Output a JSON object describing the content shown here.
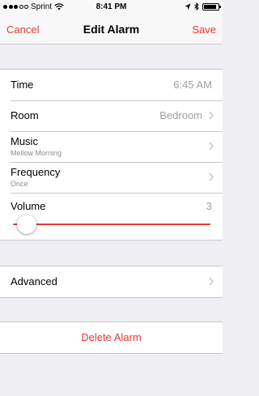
{
  "status_bar": {
    "carrier": "Sprint",
    "time": "8:41 PM",
    "icons": [
      "signal-dots",
      "wifi-icon",
      "location-arrow-icon",
      "bluetooth-icon",
      "battery-icon"
    ]
  },
  "nav": {
    "cancel_label": "Cancel",
    "title": "Edit Alarm",
    "save_label": "Save"
  },
  "settings": {
    "time": {
      "label": "Time",
      "value": "6:45 AM"
    },
    "room": {
      "label": "Room",
      "value": "Bedroom"
    },
    "music": {
      "label": "Music",
      "subtitle": "Mellow Morning"
    },
    "frequency": {
      "label": "Frequency",
      "subtitle": "Once"
    },
    "volume": {
      "label": "Volume",
      "value": "3",
      "level_fraction": 0.07
    }
  },
  "advanced": {
    "label": "Advanced"
  },
  "delete": {
    "label": "Delete Alarm"
  },
  "colors": {
    "accent": "#e53935",
    "background": "#efeff4",
    "secondary_text": "#a0a0a5"
  }
}
